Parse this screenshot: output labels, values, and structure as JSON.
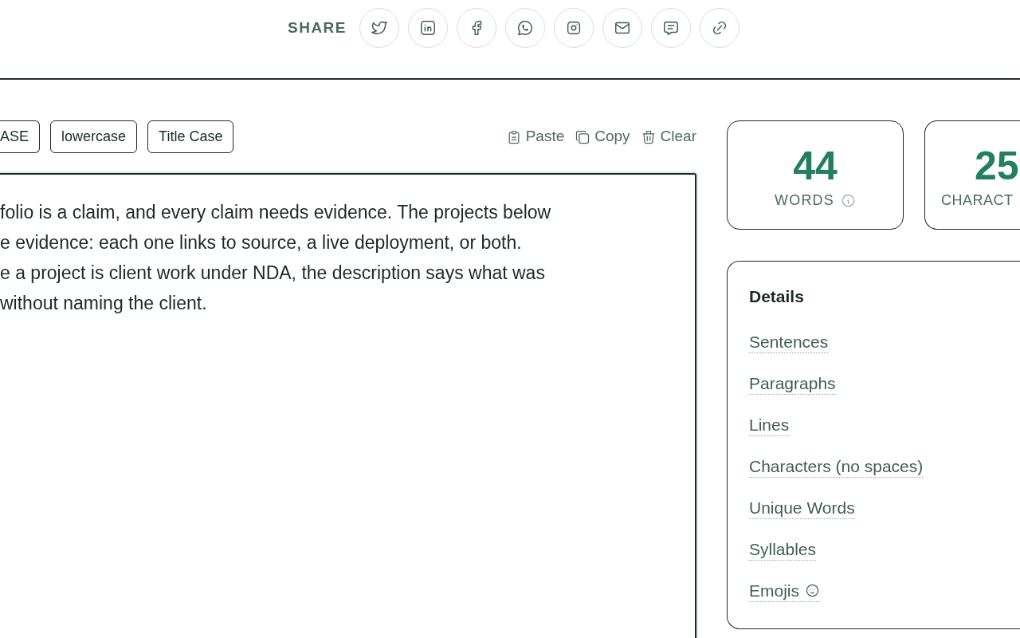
{
  "share": {
    "label": "SHARE"
  },
  "case_buttons": [
    "ASE",
    "lowercase",
    "Title Case"
  ],
  "actions": [
    {
      "kind": "paste",
      "label": "Paste"
    },
    {
      "kind": "copy",
      "label": "Copy"
    },
    {
      "kind": "clear",
      "label": "Clear"
    }
  ],
  "editor": {
    "lines": [
      "folio is a claim, and every claim needs evidence. The projects below",
      "e evidence: each one links to source, a live deployment, or both.",
      "e a project is client work under NDA, the description says what was",
      "without naming the client."
    ]
  },
  "stats": [
    {
      "value": "44",
      "label": "WORDS"
    },
    {
      "value": "25",
      "label": "CHARACT"
    }
  ],
  "details": {
    "title": "Details",
    "items": [
      {
        "label": "Sentences",
        "emoji": false
      },
      {
        "label": "Paragraphs",
        "emoji": false
      },
      {
        "label": "Lines",
        "emoji": false
      },
      {
        "label": "Characters (no spaces)",
        "emoji": false
      },
      {
        "label": "Unique Words",
        "emoji": false
      },
      {
        "label": "Syllables",
        "emoji": false
      },
      {
        "label": "Emojis",
        "emoji": true
      }
    ]
  }
}
